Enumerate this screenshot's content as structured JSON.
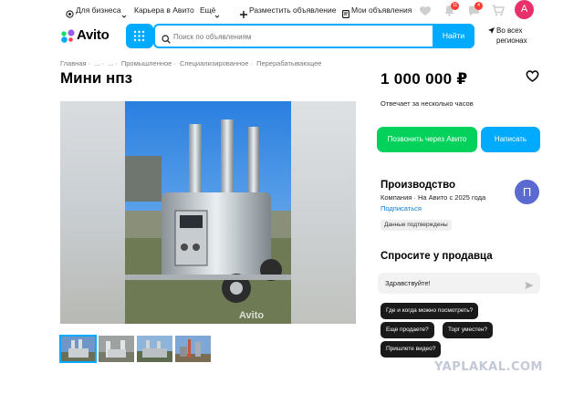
{
  "topbar": {
    "for_business": "Для бизнеса",
    "careers": "Карьера в Авито",
    "more": "Ещё",
    "post_ad": "Разместить объявление",
    "my_ads": "Мои объявления",
    "notifications_count": "11",
    "messages_count": "4",
    "user_initial": "А"
  },
  "header": {
    "logo_text": "Avito",
    "search_placeholder": "Поиск по объявлениям",
    "search_button": "Найти",
    "region_line1": "Во всех",
    "region_line2": "регионах"
  },
  "breadcrumb": [
    "Главная",
    "...",
    "...",
    "Промышленное",
    "Специализированное",
    "Перерабатывающее"
  ],
  "listing": {
    "title": "Мини нпз",
    "price": "1 000 000 ₽",
    "response_time": "Отвечает за несколько часов",
    "call_button": "Позвонить через Авито",
    "write_button": "Написать",
    "watermark": "Avito"
  },
  "seller": {
    "name": "Производство",
    "meta": "Компания · На Авито с 2025 года",
    "subscribe": "Подписаться",
    "verified": "Данные подтверждены",
    "avatar_initial": "П"
  },
  "ask": {
    "title": "Спросите у продавца",
    "input_value": "Здравствуйте!",
    "chips": [
      "Где и когда можно посмотреть?",
      "Еще продаете?",
      "Торг уместен?",
      "Пришлете видео?"
    ]
  },
  "site_watermark": "YAPLAKAL.COM",
  "colors": {
    "accent": "#00aaff",
    "call": "#02d15c",
    "avatar": "#e8306a",
    "seller_avatar": "#5b6ad0"
  }
}
